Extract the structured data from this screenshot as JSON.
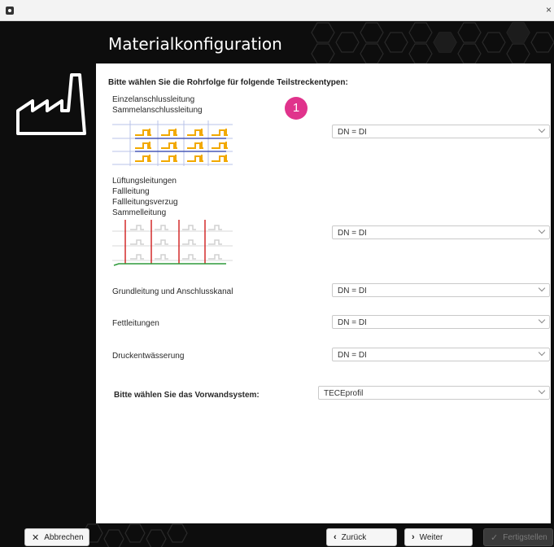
{
  "window": {
    "close_glyph": "×"
  },
  "header": {
    "title": "Materialkonfiguration"
  },
  "content": {
    "heading": "Bitte wählen Sie die Rohrfolge für folgende Teilstreckentypen:",
    "badge": "1",
    "sections": [
      {
        "labels": [
          "Einzelanschlussleitung",
          "Sammelanschlussleitung"
        ],
        "value": "DN = DI"
      },
      {
        "labels": [
          "Lüftungsleitungen",
          "Fallleitung",
          "Fallleitungsverzug",
          "Sammelleitung"
        ],
        "value": "DN = DI"
      },
      {
        "labels": [
          "Grundleitung und Anschlusskanal"
        ],
        "value": "DN = DI"
      },
      {
        "labels": [
          "Fettleitungen"
        ],
        "value": "DN = DI"
      },
      {
        "labels": [
          "Druckentwässerung"
        ],
        "value": "DN = DI"
      }
    ],
    "system": {
      "label": "Bitte wählen Sie das Vorwandsystem:",
      "value": "TECEprofil"
    }
  },
  "footer": {
    "cancel": "Abbrechen",
    "back": "Zurück",
    "next": "Weiter",
    "finish": "Fertigstellen"
  },
  "colors": {
    "accent": "#e0338c",
    "frame": "#0d0d0d",
    "pipe_highlight": "#f2a900"
  }
}
